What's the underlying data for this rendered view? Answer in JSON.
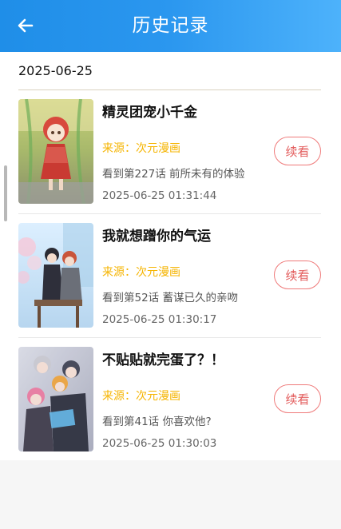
{
  "header": {
    "title": "历史记录",
    "back_icon": "arrow-left-icon",
    "gradient": [
      "#1f8ee8",
      "#4db2fb"
    ]
  },
  "date_group": "2025-06-25",
  "items": [
    {
      "title": "精灵团宠小千金",
      "source": "来源：次元漫画",
      "progress": "看到第227话 前所未有的体验",
      "time": "2025-06-25 01:31:44",
      "action": "续看"
    },
    {
      "title": "我就想蹭你的气运",
      "source": "来源：次元漫画",
      "progress": "看到第52话 蓄谋已久的亲吻",
      "time": "2025-06-25 01:30:17",
      "action": "续看"
    },
    {
      "title": "不贴贴就完蛋了？！",
      "source": "来源：次元漫画",
      "progress": "看到第41话  你喜欢他?",
      "time": "2025-06-25 01:30:03",
      "action": "续看"
    }
  ],
  "colors": {
    "source": "#f5b400",
    "continue_border": "#ef7a7a",
    "continue_text": "#e35d5d"
  }
}
